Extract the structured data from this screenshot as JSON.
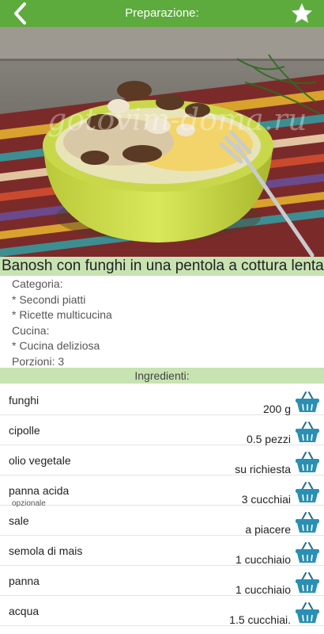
{
  "header": {
    "title": "Preparazione:",
    "back_icon": "chevron-left-icon",
    "favorite_icon": "star-icon",
    "bar_color": "#5cab3c"
  },
  "photo": {
    "watermark": "gotovim-doma.ru"
  },
  "recipe": {
    "title": "Banosh con funghi in una pentola a cottura lenta",
    "info_lines": [
      "Categoria:",
      "* Secondi piatti",
      "* Ricette multicucina",
      "Cucina:",
      "* Cucina deliziosa",
      "Porzioni: 3"
    ]
  },
  "ingredients": {
    "header": "Ingredienti:",
    "basket_icon": "shopping-basket-icon",
    "basket_color": "#2a8fb3",
    "items": [
      {
        "name": "funghi",
        "qty": "200 g",
        "note": ""
      },
      {
        "name": "cipolle",
        "qty": "0.5 pezzi",
        "note": ""
      },
      {
        "name": "olio vegetale",
        "qty": "su richiesta",
        "note": ""
      },
      {
        "name": "panna acida",
        "qty": "3 cucchiai",
        "note": "opzionale"
      },
      {
        "name": "sale",
        "qty": "a piacere",
        "note": ""
      },
      {
        "name": "semola di mais",
        "qty": "1 cucchiaio",
        "note": ""
      },
      {
        "name": "panna",
        "qty": "1 cucchiaio",
        "note": ""
      },
      {
        "name": "acqua",
        "qty": "1.5 cucchiai.",
        "note": ""
      }
    ]
  }
}
